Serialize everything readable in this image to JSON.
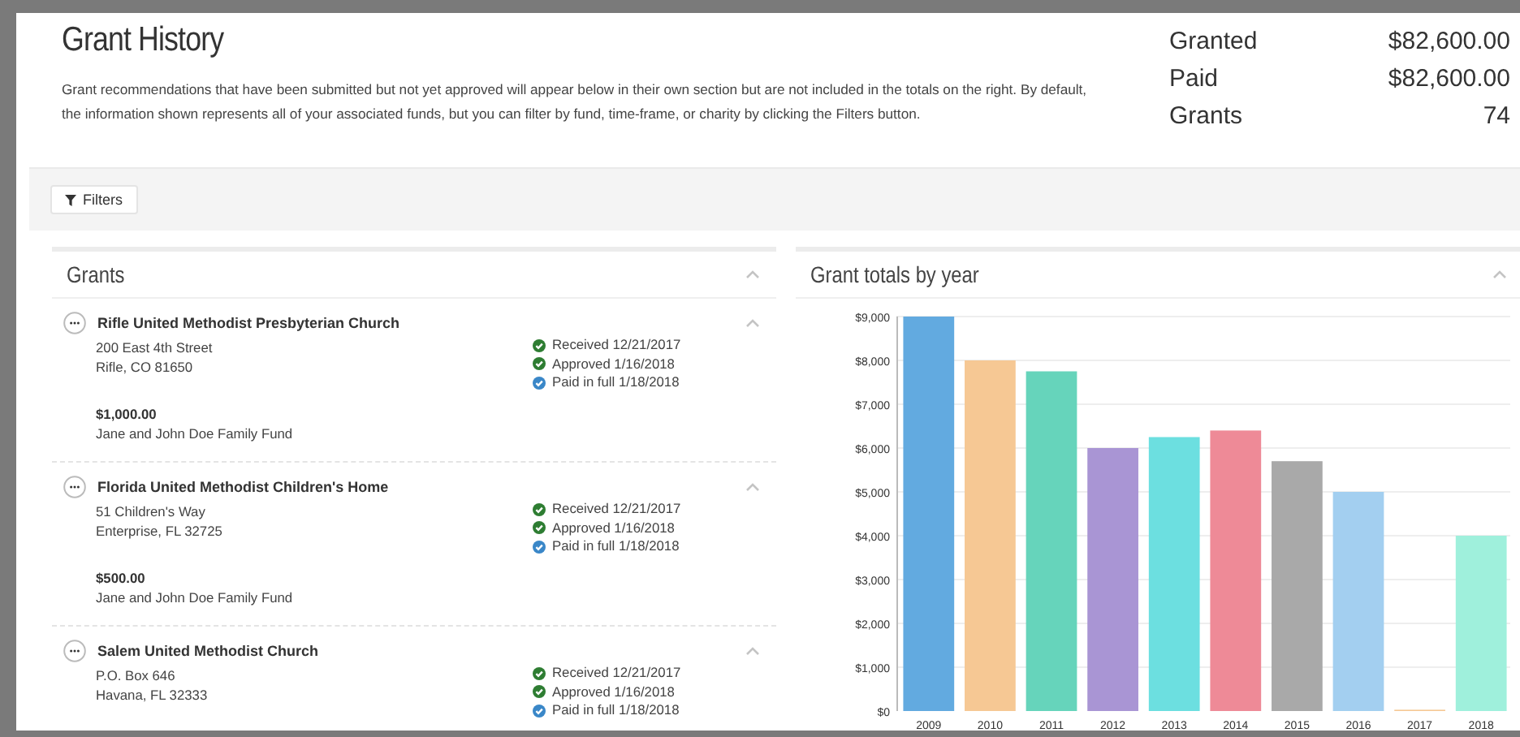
{
  "header": {
    "title": "Grant History",
    "description": "Grant recommendations that have been submitted but not yet approved will appear below in their own section but are not included in the totals on the right. By default, the information shown represents all of your associated funds, but you can filter by fund, time-frame, or charity by clicking the Filters button."
  },
  "totals": [
    {
      "label": "Granted",
      "value": "$82,600.00"
    },
    {
      "label": "Paid",
      "value": "$82,600.00"
    },
    {
      "label": "Grants",
      "value": "74"
    }
  ],
  "filters_button": "Filters",
  "grants_panel": {
    "title": "Grants",
    "expanded": true,
    "grants": [
      {
        "name": "Rifle United Methodist Presbyterian Church",
        "expanded": true,
        "address": [
          "200 East 4th Street",
          "Rifle, CO 81650"
        ],
        "amount": "$1,000.00",
        "fund": "Jane and John Doe Family Fund",
        "statuses": [
          {
            "text": "Received 12/21/2017",
            "color": "#2e7d32"
          },
          {
            "text": "Approved 1/16/2018",
            "color": "#2e7d32"
          },
          {
            "text": "Paid in full 1/18/2018",
            "color": "#3a87c8"
          }
        ]
      },
      {
        "name": "Florida United Methodist Children's Home",
        "expanded": true,
        "address": [
          "51 Children's Way",
          "Enterprise, FL 32725"
        ],
        "amount": "$500.00",
        "fund": "Jane and John Doe Family Fund",
        "statuses": [
          {
            "text": "Received 12/21/2017",
            "color": "#2e7d32"
          },
          {
            "text": "Approved 1/16/2018",
            "color": "#2e7d32"
          },
          {
            "text": "Paid in full 1/18/2018",
            "color": "#3a87c8"
          }
        ]
      },
      {
        "name": "Salem United Methodist Church",
        "expanded": true,
        "address": [
          "P.O. Box 646",
          "Havana, FL 32333"
        ],
        "statuses": [
          {
            "text": "Received 12/21/2017",
            "color": "#2e7d32"
          },
          {
            "text": "Approved 1/16/2018",
            "color": "#2e7d32"
          },
          {
            "text": "Paid in full 1/18/2018",
            "color": "#3a87c8"
          }
        ]
      }
    ]
  },
  "chart_panel": {
    "title": "Grant totals by year",
    "expanded": true,
    "chart_data": {
      "type": "bar",
      "categories": [
        "2009",
        "2010",
        "2011",
        "2012",
        "2013",
        "2014",
        "2015",
        "2016",
        "2017",
        "2018"
      ],
      "values": [
        9000,
        8000,
        7750,
        6000,
        6250,
        6400,
        5700,
        5000,
        0,
        4000
      ],
      "grid": true,
      "colors": [
        "#62aae0",
        "#f6c894",
        "#66d4bb",
        "#a995d4",
        "#6cdfe0",
        "#ee8a97",
        "#a9a9a9",
        "#a3cff0",
        "#f6c894",
        "#9ff0dc"
      ],
      "ylim": [
        0,
        9000
      ],
      "yticks": [
        {
          "value": 0,
          "label": "$0"
        },
        {
          "value": 1000,
          "label": "$1,000"
        },
        {
          "value": 2000,
          "label": "$2,000"
        },
        {
          "value": 3000,
          "label": "$3,000"
        },
        {
          "value": 4000,
          "label": "$4,000"
        },
        {
          "value": 5000,
          "label": "$5,000"
        },
        {
          "value": 6000,
          "label": "$6,000"
        },
        {
          "value": 7000,
          "label": "$7,000"
        },
        {
          "value": 8000,
          "label": "$8,000"
        },
        {
          "value": 9000,
          "label": "$9,000"
        }
      ]
    }
  }
}
